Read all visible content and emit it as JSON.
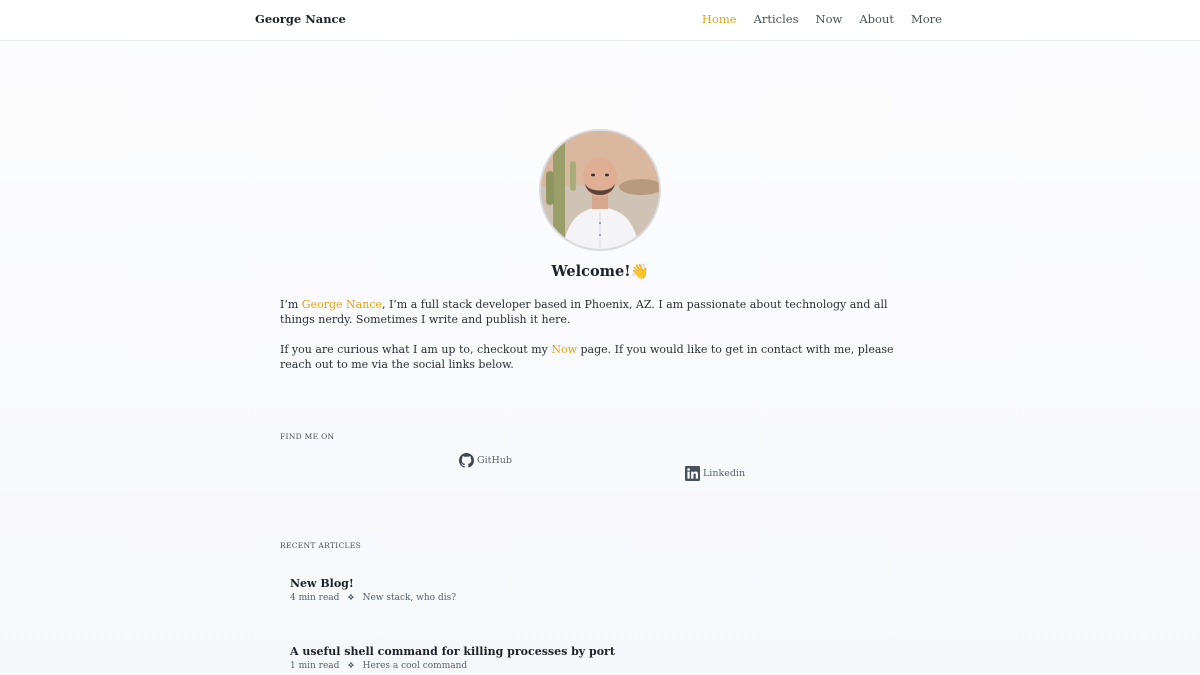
{
  "header": {
    "brand": "George Nance",
    "nav": [
      {
        "label": "Home"
      },
      {
        "label": "Articles"
      },
      {
        "label": "Now"
      },
      {
        "label": "About"
      },
      {
        "label": "More"
      }
    ]
  },
  "hero": {
    "avatar_alt": "George Nance portrait",
    "welcome": "Welcome!",
    "wave_emoji": "👋"
  },
  "intro": {
    "p1_prefix": "I’m ",
    "p1_name": "George Nance",
    "p1_suffix": ", I’m a full stack developer based in Phoenix, AZ. I am passionate about technology and all things nerdy. Sometimes I write and publish it here.",
    "p2_prefix": "If you are curious what I am up to, checkout my ",
    "p2_link": "Now",
    "p2_suffix": " page. If you would like to get in contact with me, please reach out to me via the social links below."
  },
  "social": {
    "label": "FIND ME ON",
    "github": "GitHub",
    "linkedin": "Linkedin"
  },
  "articles": {
    "label": "RECENT ARTICLES",
    "items": [
      {
        "title": "New Blog!",
        "read_time": "4 min read",
        "separator": "❖",
        "summary": "New stack, who dis?"
      },
      {
        "title": "A useful shell command for killing processes by port",
        "read_time": "1 min read",
        "separator": "❖",
        "summary": "Heres a cool command"
      }
    ]
  },
  "colors": {
    "accent": "#e0a413",
    "text": "#2b2f36",
    "muted": "#5b616b"
  }
}
